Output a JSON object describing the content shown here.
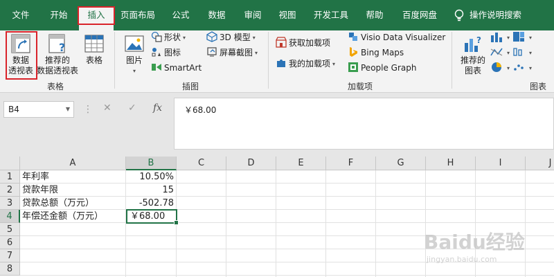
{
  "menu": {
    "tabs": [
      "文件",
      "开始",
      "插入",
      "页面布局",
      "公式",
      "数据",
      "审阅",
      "视图",
      "开发工具",
      "帮助",
      "百度网盘"
    ],
    "active": "插入",
    "tell_me": "操作说明搜索"
  },
  "ribbon": {
    "tables": {
      "label": "表格",
      "pivot_table": "数据\n透视表",
      "recommended_pivot": "推荐的\n数据透视表",
      "table": "表格"
    },
    "illustrations": {
      "label": "插图",
      "pictures": "图片",
      "shapes": "形状",
      "icons": "图标",
      "smartart": "SmartArt",
      "model_3d": "3D 模型",
      "screenshot": "屏幕截图"
    },
    "addins": {
      "label": "加载项",
      "get_addins": "获取加载项",
      "my_addins": "我的加载项",
      "visio": "Visio Data Visualizer",
      "bing_maps": "Bing Maps",
      "people_graph": "People Graph"
    },
    "charts": {
      "label": "图表",
      "recommended_charts": "推荐的\n图表"
    }
  },
  "formula_bar": {
    "name_box": "B4",
    "cancel": "✕",
    "enter": "✓",
    "fx": "fx",
    "content": "￥68.00"
  },
  "grid": {
    "columns": [
      "A",
      "B",
      "C",
      "D",
      "E",
      "F",
      "G",
      "H",
      "I",
      "J"
    ],
    "selected_column": "B",
    "selected_row": "4",
    "rows": [
      "1",
      "2",
      "3",
      "4",
      "5",
      "6",
      "7",
      "8"
    ],
    "cells": {
      "A1": "年利率",
      "B1": "10.50%",
      "A2": "贷款年限",
      "B2": "15",
      "A3": "贷款总额（万元）",
      "B3": "-502.78",
      "A4": "年偿还金额（万元）",
      "B4": "￥68.00"
    }
  },
  "colors": {
    "accent": "#217346",
    "highlight_box": "#d9232a"
  },
  "watermark": {
    "brand": "Baidu经验",
    "url": "jingyan.baidu.com"
  }
}
